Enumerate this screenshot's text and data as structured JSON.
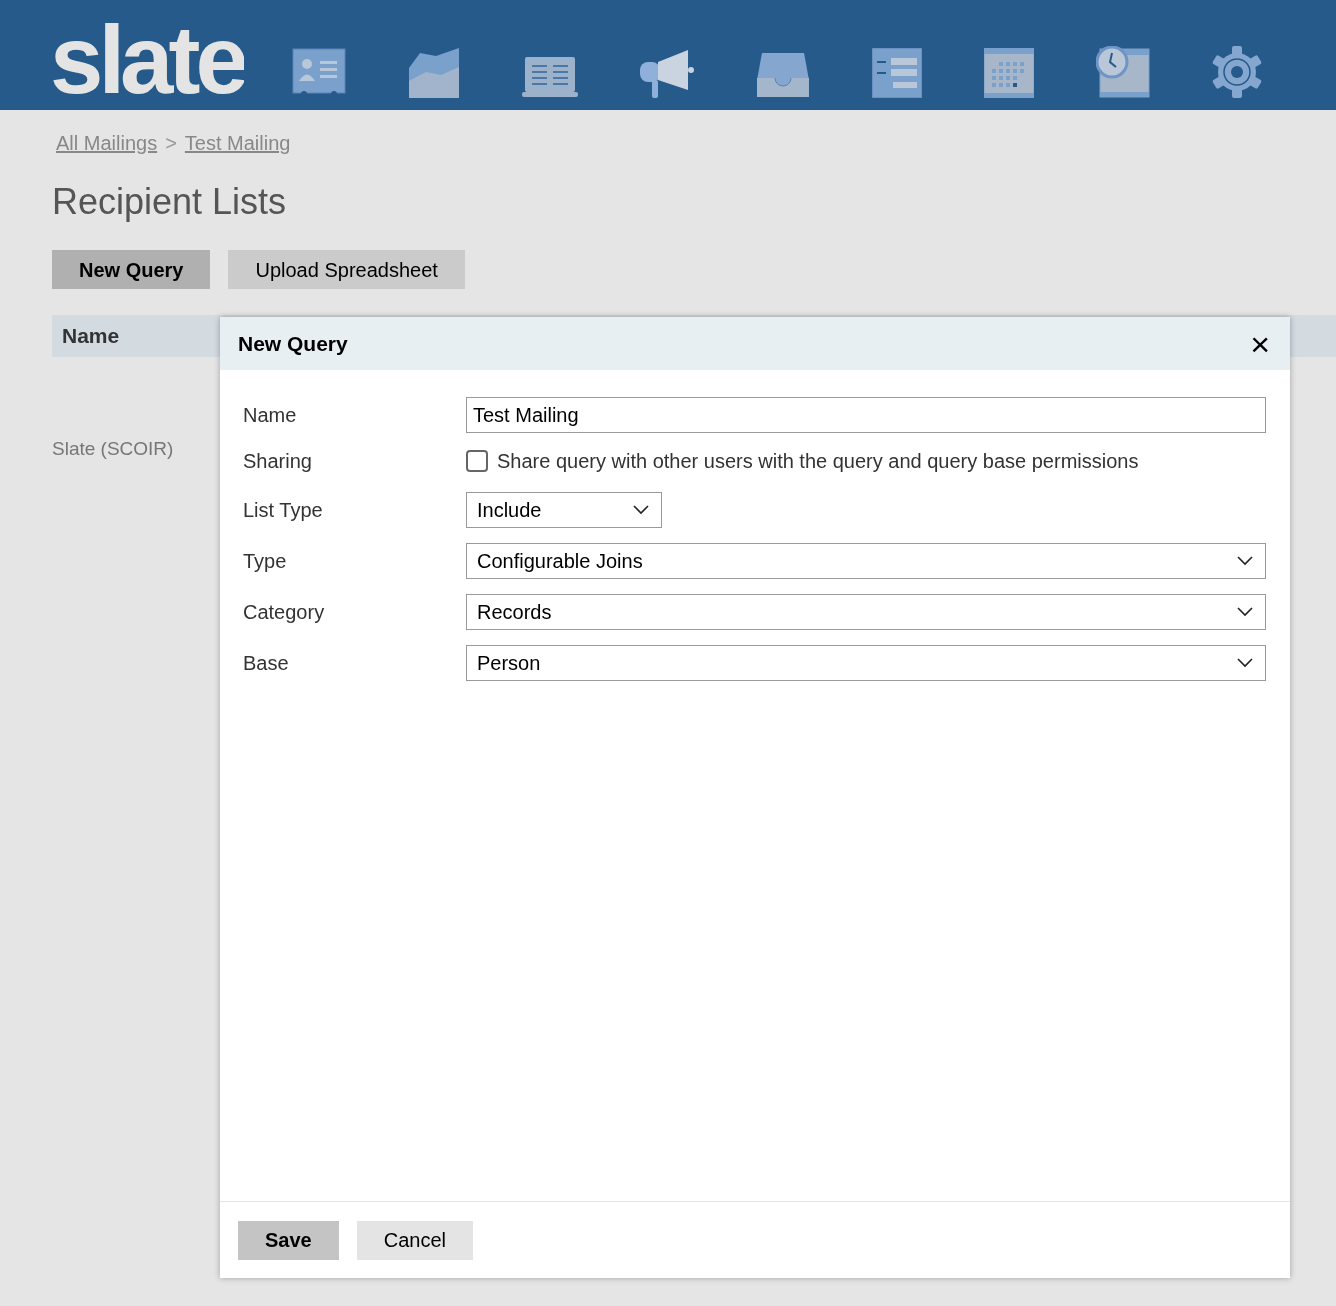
{
  "header": {
    "logo": "slate"
  },
  "breadcrumb": [
    {
      "label": "All Mailings"
    },
    {
      "label": "Test Mailing"
    }
  ],
  "breadcrumb_separator": ">",
  "page_title": "Recipient Lists",
  "actions": [
    {
      "label": "New Query",
      "selected": true
    },
    {
      "label": "Upload Spreadsheet",
      "selected": false
    }
  ],
  "table": {
    "columns": [
      "Name"
    ],
    "rows": [
      [
        "Slate (SCOIR)"
      ]
    ]
  },
  "dialog": {
    "title": "New Query",
    "close": "×",
    "fields": [
      {
        "kind": "text",
        "label": "Name",
        "value": "Test Mailing"
      },
      {
        "kind": "checkbox",
        "label": "Sharing",
        "text": "Share query with other users with the query and query base permissions",
        "checked": false
      },
      {
        "kind": "select",
        "label": "List Type",
        "value": "Include",
        "wide": false
      },
      {
        "kind": "select",
        "label": "Type",
        "value": "Configurable Joins",
        "wide": true
      },
      {
        "kind": "select",
        "label": "Category",
        "value": "Records",
        "wide": true
      },
      {
        "kind": "select",
        "label": "Base",
        "value": "Person",
        "wide": true
      }
    ],
    "buttons": [
      {
        "label": "Save",
        "primary": true
      },
      {
        "label": "Cancel",
        "primary": false
      }
    ]
  }
}
